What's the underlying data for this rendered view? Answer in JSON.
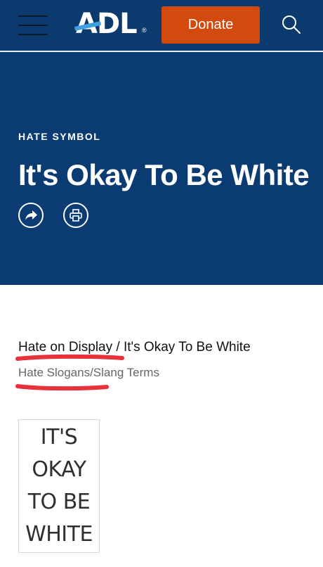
{
  "header": {
    "menu_icon": "hamburger-menu-icon",
    "logo": "ADL",
    "donate_label": "Donate",
    "search_icon": "search-icon"
  },
  "hero": {
    "kicker": "HATE SYMBOL",
    "title": "It's Okay To Be White",
    "share_icon": "share-icon",
    "print_icon": "print-icon",
    "background": "#0b3b73"
  },
  "content": {
    "breadcrumb_parent": "Hate on Display",
    "breadcrumb_separator": " / ",
    "breadcrumb_current": "It's Okay To Be White",
    "category": "Hate Slogans/Slang Terms",
    "symbol_lines": [
      "IT'S",
      "OKAY",
      "TO BE",
      "WHITE"
    ]
  },
  "colors": {
    "brand_navy": "#0b3b73",
    "donate_orange": "#d34a0e",
    "annotation_red": "#e8323a"
  }
}
